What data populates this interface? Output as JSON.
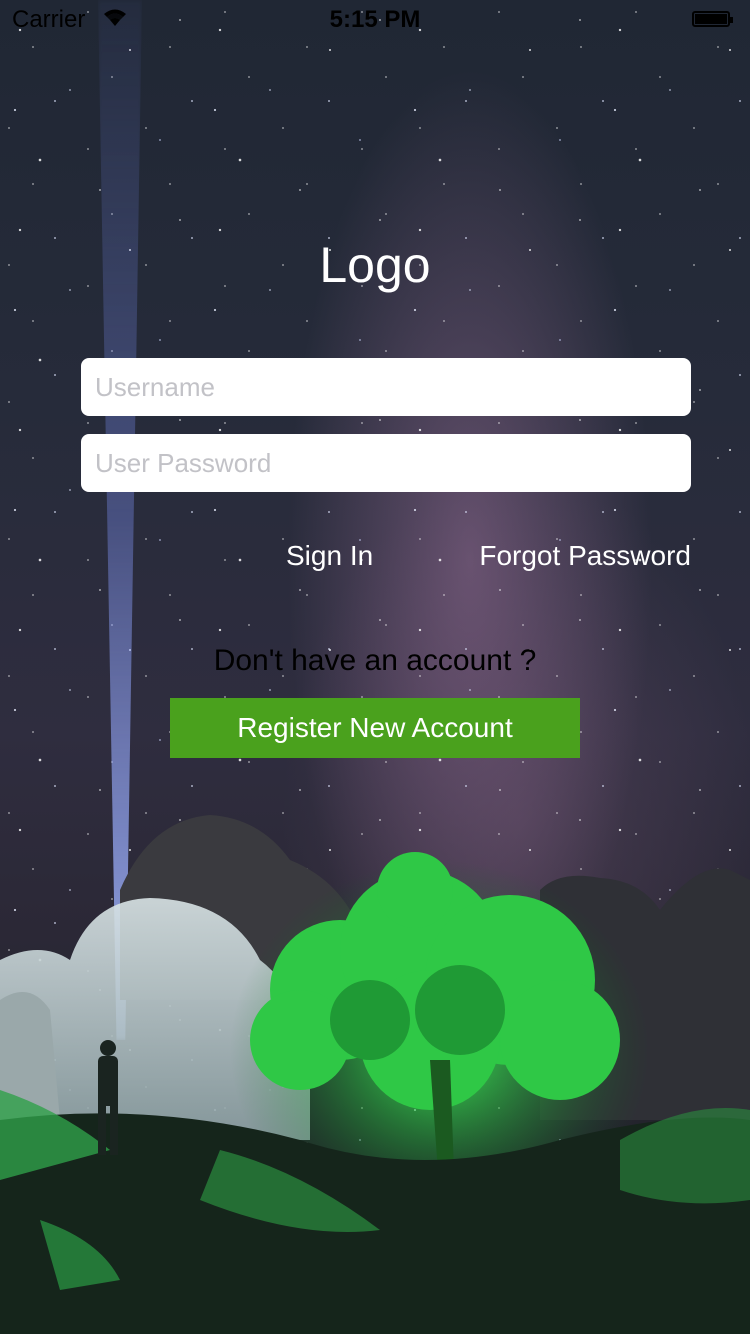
{
  "status_bar": {
    "carrier": "Carrier",
    "time": "5:15 PM"
  },
  "logo": "Logo",
  "form": {
    "username_placeholder": "Username",
    "password_placeholder": "User Password"
  },
  "actions": {
    "sign_in": "Sign In",
    "forgot_password": "Forgot Password"
  },
  "register": {
    "prompt": "Don't have an account ?",
    "button_label": "Register New Account"
  },
  "colors": {
    "register_button": "#4aa11d",
    "text_light": "#ffffff"
  }
}
